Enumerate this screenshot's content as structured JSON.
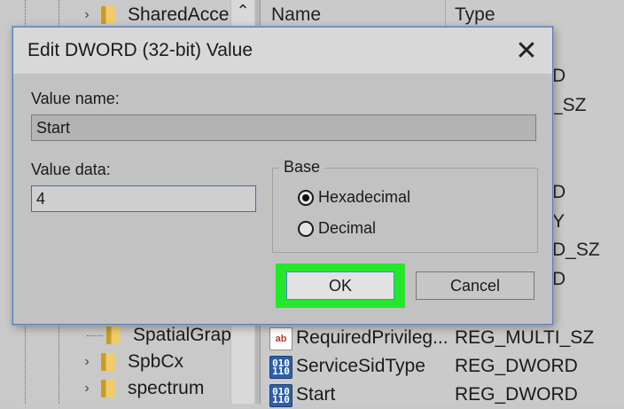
{
  "tree": {
    "items": [
      {
        "label": "SharedAcce",
        "expander": "›"
      },
      {
        "label": "SpatialGrap",
        "expander": ""
      },
      {
        "label": "SpbCx",
        "expander": "›"
      },
      {
        "label": "spectrum",
        "expander": "›"
      }
    ],
    "scroll_up_glyph": "⌃"
  },
  "list": {
    "header": {
      "name": "Name",
      "type": "Type"
    },
    "type_fragments": [
      "D",
      "_SZ",
      "D",
      "Y",
      "D_SZ",
      "D"
    ],
    "rows": [
      {
        "icon": "ab",
        "name": "RequiredPrivileg...",
        "type": "REG_MULTI_SZ"
      },
      {
        "icon": "bin",
        "name": "ServiceSidType",
        "type": "REG_DWORD"
      },
      {
        "icon": "bin",
        "name": "Start",
        "type": "REG_DWORD"
      }
    ]
  },
  "dialog": {
    "title": "Edit DWORD (32-bit) Value",
    "close_glyph": "✕",
    "value_name_label": "Value name:",
    "value_name": "Start",
    "value_data_label": "Value data:",
    "value_data": "4",
    "base_label": "Base",
    "base_options": [
      {
        "label": "Hexadecimal",
        "checked": true
      },
      {
        "label": "Decimal",
        "checked": false
      }
    ],
    "ok_label": "OK",
    "cancel_label": "Cancel",
    "ok_highlight_color": "#25e62c"
  },
  "colors": {
    "dialog_border": "#5b7fb1",
    "focus_border": "#3b6db3"
  }
}
